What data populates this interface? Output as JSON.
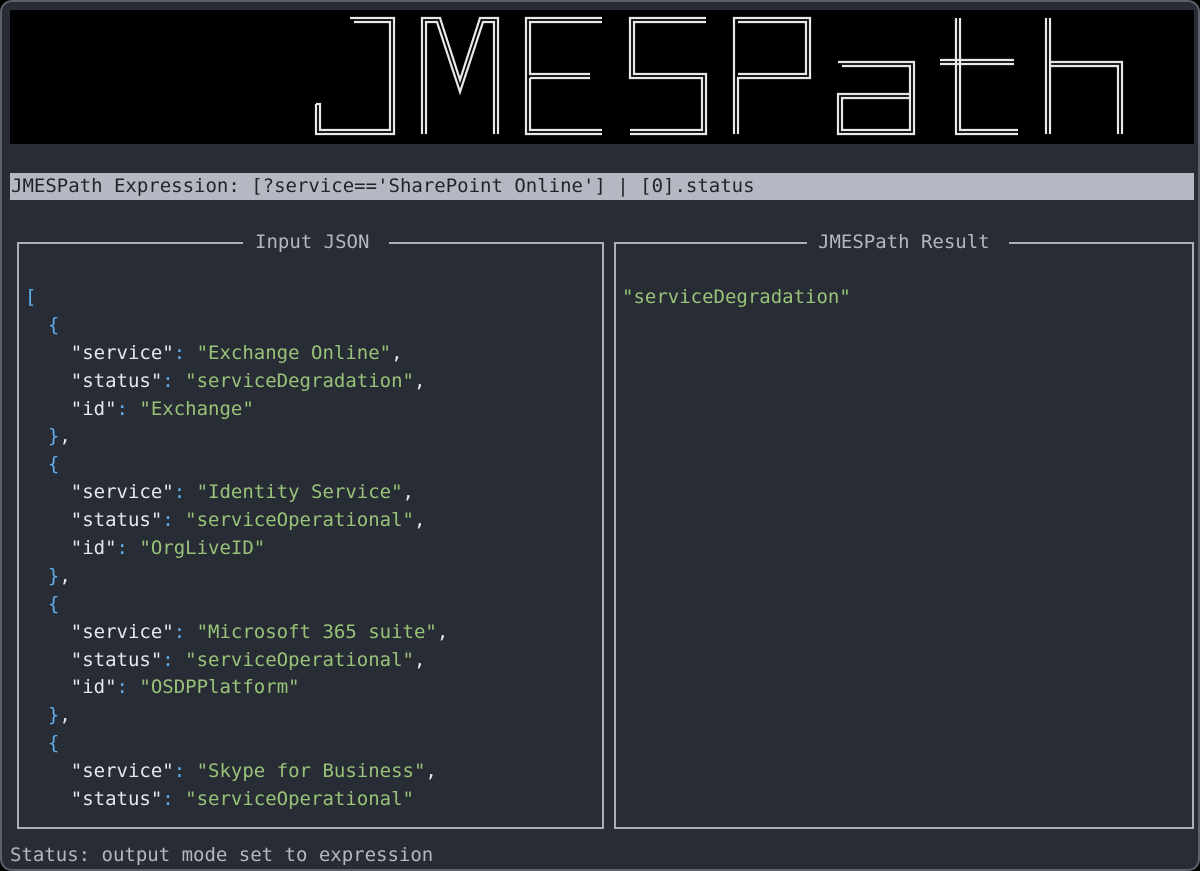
{
  "banner": {
    "text": "JMESPath"
  },
  "expression": {
    "label": "JMESPath Expression:",
    "value": "[?service=='SharePoint Online'] | [0].status"
  },
  "input_panel": {
    "title": "Input JSON",
    "items": [
      {
        "service": "Exchange Online",
        "status": "serviceDegradation",
        "id": "Exchange"
      },
      {
        "service": "Identity Service",
        "status": "serviceOperational",
        "id": "OrgLiveID"
      },
      {
        "service": "Microsoft 365 suite",
        "status": "serviceOperational",
        "id": "OSDPPlatform"
      },
      {
        "service": "Skype for Business",
        "status": "serviceOperational"
      }
    ]
  },
  "result_panel": {
    "title": "JMESPath Result",
    "value": "\"serviceDegradation\""
  },
  "status_bar": {
    "text": "Status: output mode set to expression"
  },
  "colors": {
    "background": "#282c34",
    "expression_bar": "#b3b8c2",
    "brace": "#61afef",
    "string": "#98c379",
    "key": "#e6e8ec"
  }
}
